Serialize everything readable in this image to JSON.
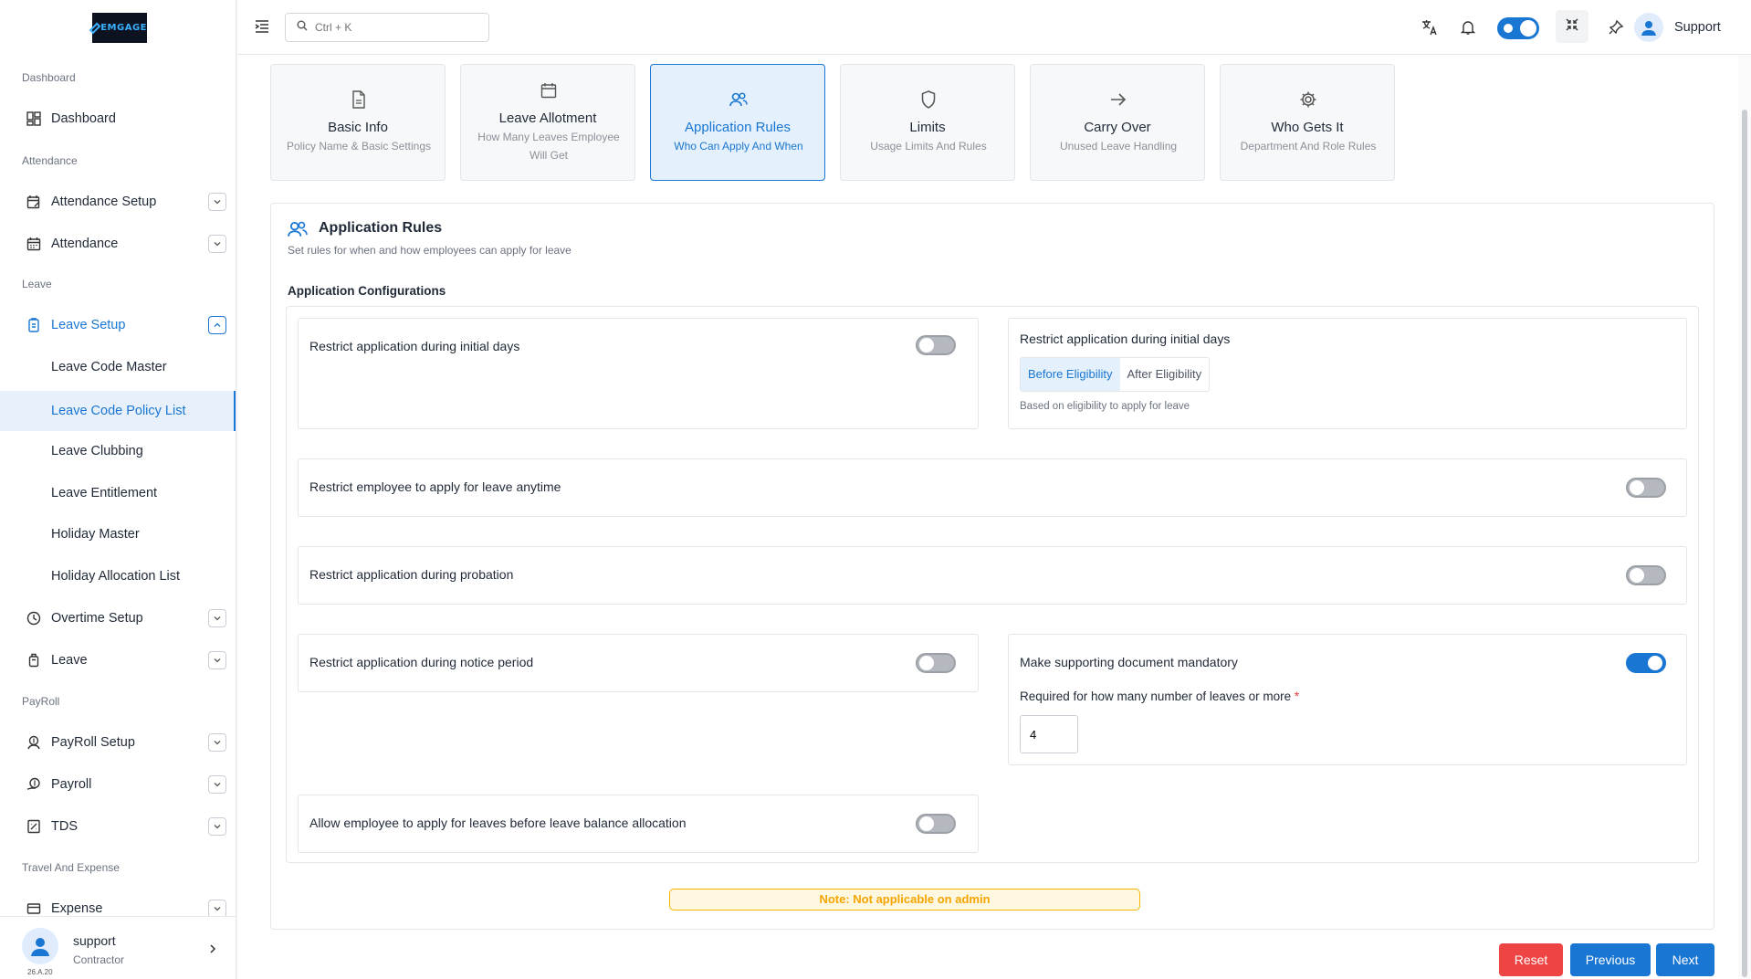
{
  "sidebar": {
    "logo_text": "EMGAGE",
    "sections": {
      "dashboard": "Dashboard",
      "attendance": "Attendance",
      "leave": "Leave",
      "payroll": "PayRoll",
      "travel": "Travel And Expense"
    },
    "items": {
      "dashboard": "Dashboard",
      "attendance_setup": "Attendance Setup",
      "attendance": "Attendance",
      "leave_setup": "Leave Setup",
      "leave_code_master": "Leave Code Master",
      "leave_code_policy_list": "Leave Code Policy List",
      "leave_clubbing": "Leave Clubbing",
      "leave_entitlement": "Leave Entitlement",
      "holiday_master": "Holiday Master",
      "holiday_allocation_list": "Holiday Allocation List",
      "overtime_setup": "Overtime Setup",
      "leave": "Leave",
      "payroll_setup": "PayRoll Setup",
      "payroll": "Payroll",
      "tds": "TDS",
      "expense": "Expense"
    },
    "user": {
      "name": "support",
      "role": "Contractor",
      "version": "26.A.20"
    }
  },
  "topbar": {
    "search_placeholder": "Ctrl + K",
    "user_name": "Support"
  },
  "steps": [
    {
      "title": "Basic Info",
      "desc": "Policy Name & Basic Settings"
    },
    {
      "title": "Leave Allotment",
      "desc": "How Many Leaves Employee Will Get"
    },
    {
      "title": "Application Rules",
      "desc": "Who Can Apply And When"
    },
    {
      "title": "Limits",
      "desc": "Usage Limits And Rules"
    },
    {
      "title": "Carry Over",
      "desc": "Unused Leave Handling"
    },
    {
      "title": "Who Gets It",
      "desc": "Department And Role Rules"
    }
  ],
  "card": {
    "title": "Application Rules",
    "subtitle": "Set rules for when and how employees can apply for leave",
    "config_title": "Application Configurations"
  },
  "rules": {
    "initial_days": {
      "label": "Restrict application during initial days",
      "enabled": false
    },
    "initial_days_mode": {
      "label": "Restrict application during initial days",
      "options": [
        "Before Eligibility",
        "After Eligibility"
      ],
      "selected": "Before Eligibility",
      "hint": "Based on eligibility to apply for leave"
    },
    "anytime": {
      "label": "Restrict employee to apply for leave anytime",
      "enabled": false
    },
    "probation": {
      "label": "Restrict application during probation",
      "enabled": false
    },
    "notice": {
      "label": "Restrict application during notice period",
      "enabled": false
    },
    "document": {
      "label": "Make supporting document mandatory",
      "enabled": true,
      "count_label": "Required for how many number of leaves or more",
      "required_mark": "*",
      "count_value": "4"
    },
    "before_allocation": {
      "label": "Allow employee to apply for leaves before leave balance allocation",
      "enabled": false
    }
  },
  "note": "Note: Not applicable on admin",
  "buttons": {
    "reset": "Reset",
    "previous": "Previous",
    "next": "Next"
  },
  "colors": {
    "accent": "#1976d2",
    "reset": "#ef4444",
    "note": "#f5a400"
  }
}
